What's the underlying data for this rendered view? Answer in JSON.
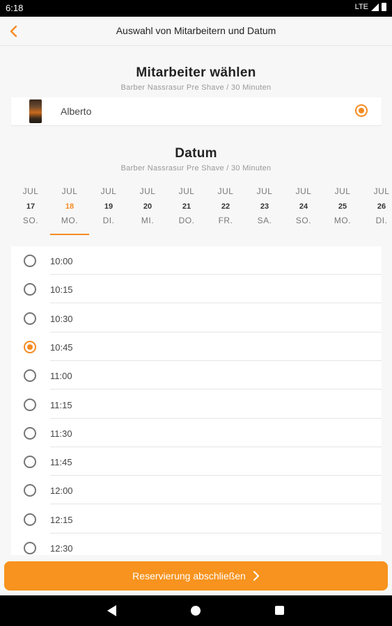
{
  "status_bar": {
    "time": "6:18",
    "network": "LTE"
  },
  "header": {
    "title": "Auswahl von Mitarbeitern und Datum"
  },
  "employee_section": {
    "title": "Mitarbeiter wählen",
    "subtitle": "Barber Nassrasur Pre Shave / 30 Minuten",
    "employee": {
      "name": "Alberto",
      "selected": true
    }
  },
  "date_section": {
    "title": "Datum",
    "subtitle": "Barber Nassrasur Pre Shave / 30 Minuten",
    "dates": [
      {
        "month": "JUL",
        "day": "17",
        "weekday": "SO."
      },
      {
        "month": "JUL",
        "day": "18",
        "weekday": "MO.",
        "active": true
      },
      {
        "month": "JUL",
        "day": "19",
        "weekday": "DI."
      },
      {
        "month": "JUL",
        "day": "20",
        "weekday": "MI."
      },
      {
        "month": "JUL",
        "day": "21",
        "weekday": "DO."
      },
      {
        "month": "JUL",
        "day": "22",
        "weekday": "FR."
      },
      {
        "month": "JUL",
        "day": "23",
        "weekday": "SA."
      },
      {
        "month": "JUL",
        "day": "24",
        "weekday": "SO."
      },
      {
        "month": "JUL",
        "day": "25",
        "weekday": "MO."
      },
      {
        "month": "JUL",
        "day": "26",
        "weekday": "DI."
      }
    ]
  },
  "time_slots": [
    {
      "time": "10:00",
      "selected": false
    },
    {
      "time": "10:15",
      "selected": false
    },
    {
      "time": "10:30",
      "selected": false
    },
    {
      "time": "10:45",
      "selected": true
    },
    {
      "time": "11:00",
      "selected": false
    },
    {
      "time": "11:15",
      "selected": false
    },
    {
      "time": "11:30",
      "selected": false
    },
    {
      "time": "11:45",
      "selected": false
    },
    {
      "time": "12:00",
      "selected": false
    },
    {
      "time": "12:15",
      "selected": false
    },
    {
      "time": "12:30",
      "selected": false
    }
  ],
  "footer": {
    "reserve_label": "Reservierung abschließen"
  },
  "colors": {
    "accent": "#f7931e",
    "radio_off": "#757575",
    "background": "#f7f7f7"
  }
}
